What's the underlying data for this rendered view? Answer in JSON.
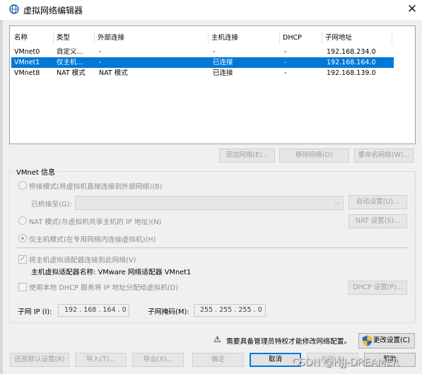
{
  "window": {
    "title": "虚拟网络编辑器",
    "close_glyph": "✕"
  },
  "table": {
    "headers": [
      "名称",
      "类型",
      "外部连接",
      "主机连接",
      "DHCP",
      "子网地址"
    ],
    "rows": [
      [
        "VMnet0",
        "自定义...",
        "-",
        "-",
        "-",
        "192.168.234.0"
      ],
      [
        "VMnet1",
        "仅主机...",
        "-",
        "已连接",
        "-",
        "192.168.164.0"
      ],
      [
        "VMnet8",
        "NAT 模式",
        "NAT 模式",
        "已连接",
        "-",
        "192.168.139.0"
      ]
    ],
    "selected_row": 1
  },
  "table_buttons": {
    "add": "添加网络(E)...",
    "remove": "移除网络(O)",
    "rename": "重命名网络(W)..."
  },
  "info": {
    "group_title": "VMnet 信息",
    "bridge_label": "桥接模式(将虚拟机直接连接到外部网络)(B)",
    "bridged_to_label": "已桥接至(G):",
    "bridged_to_value": "",
    "auto_settings": "自动设置(U)...",
    "nat_label": "NAT 模式(与虚拟机共享主机的 IP 地址)(N)",
    "nat_settings": "NAT 设置(S)...",
    "hostonly_label": "仅主机模式(在专用网络内连接虚拟机)(H)",
    "connect_adapter_label": "将主机虚拟适配器连接到此网络(V)",
    "adapter_name_label": "主机虚拟适配器名称: VMware 网络适配器 VMnet1",
    "dhcp_label": "使用本地 DHCP 服务将 IP 地址分配给虚拟机(D)",
    "dhcp_settings": "DHCP 设置(P)...",
    "subnet_ip_label": "子网 IP (I):",
    "subnet_ip_value": "192 . 168 . 164 .  0",
    "subnet_mask_label": "子网掩码(M):",
    "subnet_mask_value": "255 . 255 . 255 .  0"
  },
  "admin": {
    "warning_glyph": "⚠",
    "notice": "需要具备管理员特权才能修改网络配置。",
    "change_settings": "更改设置(C)"
  },
  "footer": {
    "restore": "还原默认设置(R)",
    "import": "导入(T)...",
    "export": "导出(X)...",
    "ok": "确定",
    "cancel": "取消",
    "apply": "应用(A)",
    "help": "帮助"
  },
  "watermark": "CSDN @HJJ-DREAMER",
  "colors": {
    "selection": "#0078d7",
    "dialog_bg": "#f0f0f0"
  }
}
